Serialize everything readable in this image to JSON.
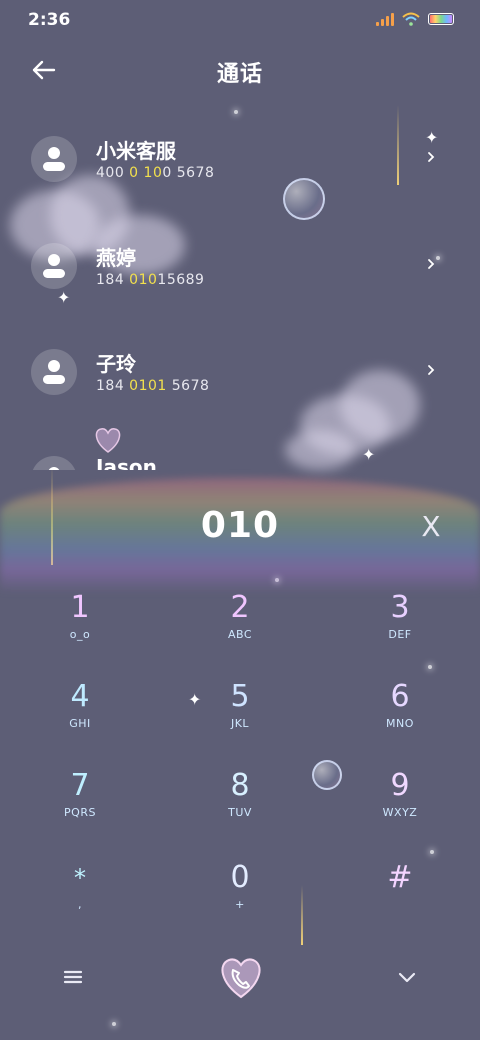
{
  "status_bar": {
    "time": "2:36"
  },
  "header": {
    "title": "通话"
  },
  "contacts": [
    {
      "name": "小米客服",
      "number_parts": [
        "400 ",
        "0",
        " ",
        "10",
        "0 5678"
      ]
    },
    {
      "name": "燕婷",
      "number_parts": [
        "184 ",
        "010",
        "15689",
        "",
        ""
      ]
    },
    {
      "name": "子玲",
      "number_parts": [
        "184 ",
        "0101",
        " 5678",
        "",
        ""
      ]
    },
    {
      "name": "Jason",
      "number_parts": [
        "",
        "",
        "",
        "",
        ""
      ]
    }
  ],
  "dialer": {
    "input": "010",
    "clear_label": "X"
  },
  "keypad": [
    {
      "digit": "1",
      "letters": "o_o"
    },
    {
      "digit": "2",
      "letters": "ABC"
    },
    {
      "digit": "3",
      "letters": "DEF"
    },
    {
      "digit": "4",
      "letters": "GHI"
    },
    {
      "digit": "5",
      "letters": "JKL"
    },
    {
      "digit": "6",
      "letters": "MNO"
    },
    {
      "digit": "7",
      "letters": "PQRS"
    },
    {
      "digit": "8",
      "letters": "TUV"
    },
    {
      "digit": "9",
      "letters": "WXYZ"
    },
    {
      "digit": "*",
      "letters": ","
    },
    {
      "digit": "0",
      "letters": "+"
    },
    {
      "digit": "#",
      "letters": ""
    }
  ],
  "icons": {
    "back": "arrow-left-icon",
    "menu": "hamburger-icon",
    "call": "heart-phone-icon",
    "collapse": "chevron-down-icon"
  },
  "colors": {
    "background": "#5d5e76",
    "highlight": "#f2e04d"
  }
}
